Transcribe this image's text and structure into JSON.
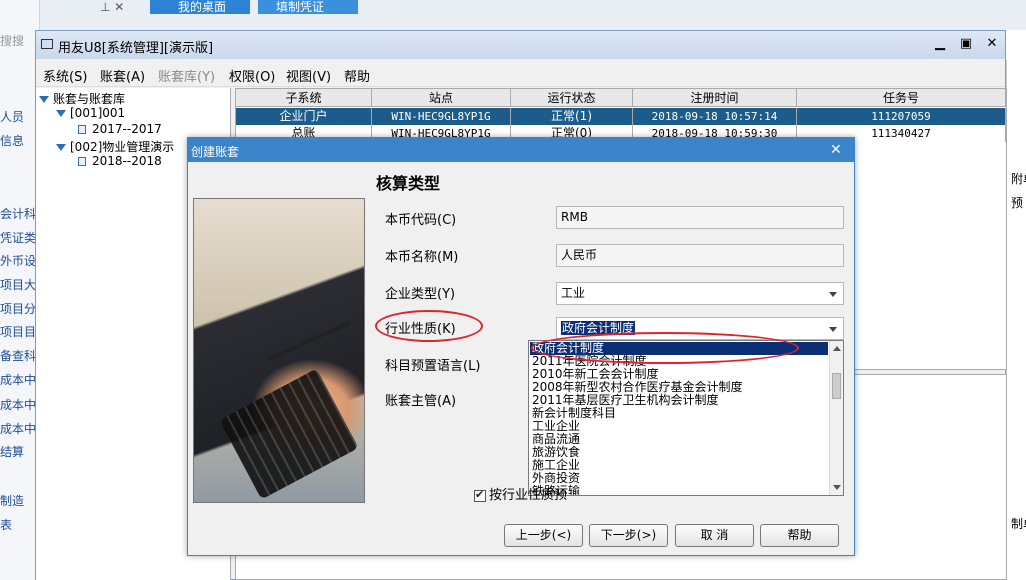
{
  "background": {
    "tabs": [
      "我的桌面",
      "填制凭证"
    ],
    "search_hint": "搜搜",
    "left_items": [
      "人员",
      "信息",
      "会计科目",
      "凭证类别",
      "外币设置",
      "项目大类",
      "项目分类",
      "项目目录",
      "备查科目",
      "成本中心",
      "成本中心",
      "成本中心",
      "结算",
      "制造",
      "表"
    ],
    "right_items": [
      "附单",
      "预",
      "制单"
    ]
  },
  "sys_window": {
    "title": "用友U8[系统管理][演示版]",
    "menu": [
      "系统(S)",
      "账套(A)",
      "账套库(Y)",
      "权限(O)",
      "视图(V)",
      "帮助"
    ],
    "tree": {
      "root": "账套与账套库",
      "items": [
        {
          "label": "[001]001",
          "year": "2017--2017"
        },
        {
          "label": "[002]物业管理演示",
          "year": "2018--2018"
        }
      ]
    },
    "table": {
      "headers": [
        "子系统",
        "站点",
        "运行状态",
        "注册时间",
        "任务号"
      ],
      "rows": [
        [
          "企业门户",
          "WIN-HEC9GL8YP1G",
          "正常(1)",
          "2018-09-18 10:57:14",
          "111207059"
        ],
        [
          "总账",
          "WIN-HEC9GL8YP1G",
          "正常(0)",
          "2018-09-18 10:59:30",
          "111340427"
        ]
      ]
    }
  },
  "dialog": {
    "title": "创建账套",
    "heading": "核算类型",
    "fields": {
      "currency_code_label": "本币代码(C)",
      "currency_code_value": "RMB",
      "currency_name_label": "本币名称(M)",
      "currency_name_value": "人民币",
      "enterprise_type_label": "企业类型(Y)",
      "enterprise_type_value": "工业",
      "industry_label": "行业性质(K)",
      "industry_value": "政府会计制度",
      "language_label": "科目预置语言(L)",
      "supervisor_label": "账套主管(A)"
    },
    "industry_options": [
      "政府会计制度",
      "2011年医院会计制度",
      "2010年新工会会计制度",
      "2008年新型农村合作医疗基金会计制度",
      "2011年基层医疗卫生机构会计制度",
      "新会计制度科目",
      "工业企业",
      "商品流通",
      "旅游饮食",
      "施工企业",
      "外商投资",
      "铁路运输"
    ],
    "checkbox_label": "按行业性质预",
    "buttons": {
      "prev": "上一步(<)",
      "next": "下一步(>)",
      "cancel": "取 消",
      "help": "帮助"
    }
  },
  "colors": {
    "accent": "#3b84c9",
    "selection": "#0b2f74",
    "highlight_ring": "#e0242b"
  }
}
